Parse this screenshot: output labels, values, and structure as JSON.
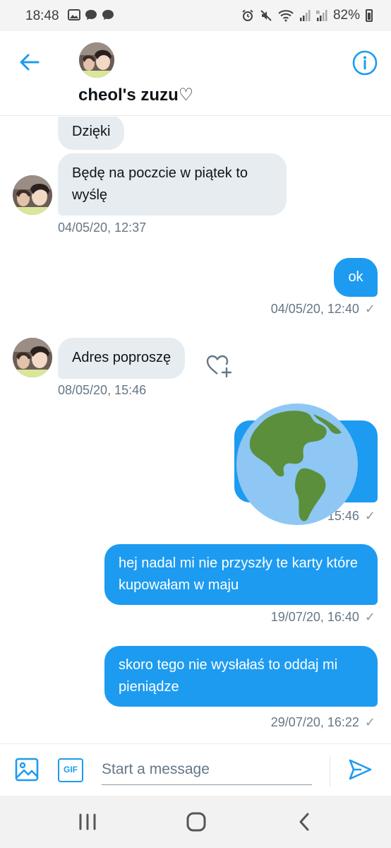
{
  "status_bar": {
    "time": "18:48",
    "battery": "82%",
    "left_icons": [
      "image-icon",
      "chat-bubble-icon",
      "chat-bubble-icon"
    ],
    "right_icons": [
      "alarm-icon",
      "mute-icon",
      "wifi-icon",
      "signal-icon",
      "signal-r-icon",
      "battery-icon"
    ]
  },
  "header": {
    "title": "cheol's zuzu♡",
    "back_icon": "arrow-left-icon",
    "info_icon": "info-icon"
  },
  "messages": [
    {
      "side": "in",
      "text": "Dzięki"
    },
    {
      "side": "in",
      "text": "Będę na poczcie w piątek to wyślę",
      "timestamp": "04/05/20, 12:37"
    },
    {
      "side": "out",
      "text": "ok",
      "timestamp": "04/05/20, 12:40"
    },
    {
      "side": "in",
      "text": "Adres poproszę",
      "timestamp": "08/05/20, 15:46"
    },
    {
      "side": "out",
      "text": "",
      "timestamp_visible": "15:46",
      "sticker": "globe-americas-emoji"
    },
    {
      "side": "out",
      "text": "hej nadal mi nie przyszły te karty które kupowałam w maju",
      "timestamp": "19/07/20, 16:40"
    },
    {
      "side": "out",
      "text": "skoro tego nie wysłałaś to oddaj mi pieniądze",
      "timestamp": "29/07/20, 16:22"
    }
  ],
  "composer": {
    "placeholder": "Start a message",
    "gif_label": "GIF"
  },
  "colors": {
    "accent": "#1d9bf0",
    "incoming_bubble": "#e6ecf0",
    "timestamp": "#657786"
  }
}
